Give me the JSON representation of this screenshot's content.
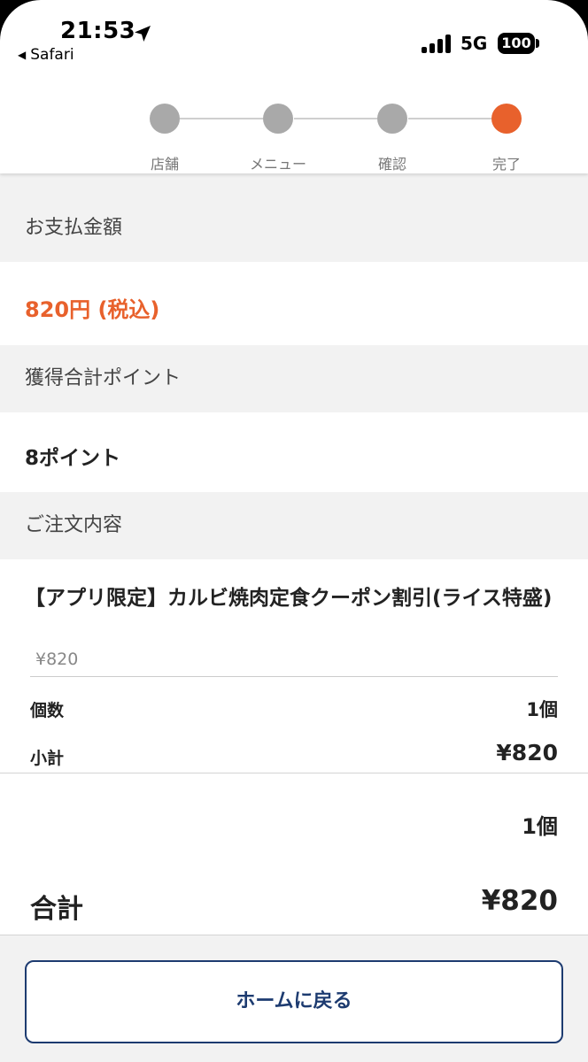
{
  "status_bar": {
    "time": "21:53",
    "back_app": "Safari",
    "network": "5G",
    "battery": "100"
  },
  "stepper": {
    "steps": [
      "店舗",
      "メニュー",
      "確認",
      "完了"
    ],
    "active_index": 3,
    "active_color": "#e8612c",
    "inactive_color": "#a9a9a9"
  },
  "payment": {
    "heading": "お支払金額",
    "amount": "820円 (税込)"
  },
  "points": {
    "heading": "獲得合計ポイント",
    "value": "8ポイント"
  },
  "order": {
    "heading": "ご注文内容",
    "item_name": "【アプリ限定】カルビ焼肉定食クーポン割引(ライス特盛)",
    "item_price": "¥820",
    "quantity_label": "個数",
    "quantity_value": "1個",
    "subtotal_label": "小計",
    "subtotal_value": "¥820"
  },
  "totals": {
    "quantity": "1個",
    "label": "合計",
    "value": "¥820"
  },
  "actions": {
    "home_button": "ホームに戻る"
  },
  "colors": {
    "accent": "#e8612c",
    "button_border": "#1d3b70"
  }
}
